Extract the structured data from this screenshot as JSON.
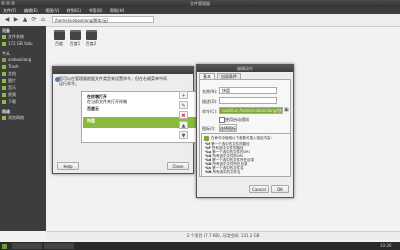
{
  "window": {
    "title": "文件管理器",
    "min": "–",
    "max": "▢",
    "close": "✕"
  },
  "menubar": {
    "items": [
      "文件(F)",
      "编辑(E)",
      "视图(V)",
      "转到(G)",
      "书签(B)",
      "帮助(H)"
    ]
  },
  "toolbar": {
    "path": "/home/xiebooliang/脚本/云/"
  },
  "sidebar": {
    "sections": [
      {
        "title": "设备",
        "items": [
          "文件系统",
          "172 GB Volu"
        ]
      },
      {
        "title": "个人",
        "items": [
          "xiebooliang",
          "Trash",
          "文档",
          "图片",
          "音乐",
          "视频",
          "下载"
        ]
      },
      {
        "title": "网络",
        "items": [
          "浏览网络"
        ]
      }
    ]
  },
  "files": [
    "百度",
    "百度1",
    "百度2"
  ],
  "status": "3 个项目 (7.7 KB), 可用空间: 131.2 GB",
  "dialog1": {
    "title": "",
    "message": "您可以在管理器根据文件类型来设置命令，但在右键菜单中再运行命令。",
    "items": [
      {
        "name": "在终端打开",
        "desc": "在当前文件夹打开终端",
        "selected": false
      },
      {
        "name": "百度云",
        "desc": "",
        "selected": false
      },
      {
        "name": "快盘",
        "desc": "",
        "selected": true
      }
    ],
    "side_buttons": [
      "+",
      "✎",
      "✖",
      "▲",
      "▼"
    ],
    "help": "Help",
    "close": "Close"
  },
  "dialog2": {
    "title": "编辑动作",
    "tabs": [
      "基本",
      "出现条件"
    ],
    "name_label": "名称(N):",
    "name_value": "快盘",
    "desc_label": "描述(D):",
    "desc_value": "",
    "cmd_label": "命令(C):",
    "cmd_value": "nautilus /home/xiebooliang/快盘 %f",
    "startup_label": "使用启动通知",
    "icon_label": "图标(I):",
    "icon_button": "选择图标",
    "help_intro": "在命令中使用以下参数可插入相应内容：",
    "help_items": [
      {
        "code": "%f",
        "text": "第一个选中的文件的路径"
      },
      {
        "code": "%F",
        "text": "所有选中文件的路径"
      },
      {
        "code": "%u",
        "text": "第一个选中的文件的URI"
      },
      {
        "code": "%U",
        "text": "所有选中文件的URI"
      },
      {
        "code": "%d",
        "text": "第一个选中的文件所在目录"
      },
      {
        "code": "%D",
        "text": "所有选中文件所在目录"
      },
      {
        "code": "%n",
        "text": "第一个选中的文件名"
      },
      {
        "code": "%N",
        "text": "所有选中的文件名"
      }
    ],
    "cancel": "Cancel",
    "ok": "OK"
  },
  "taskbar": {
    "time": "10:26"
  }
}
